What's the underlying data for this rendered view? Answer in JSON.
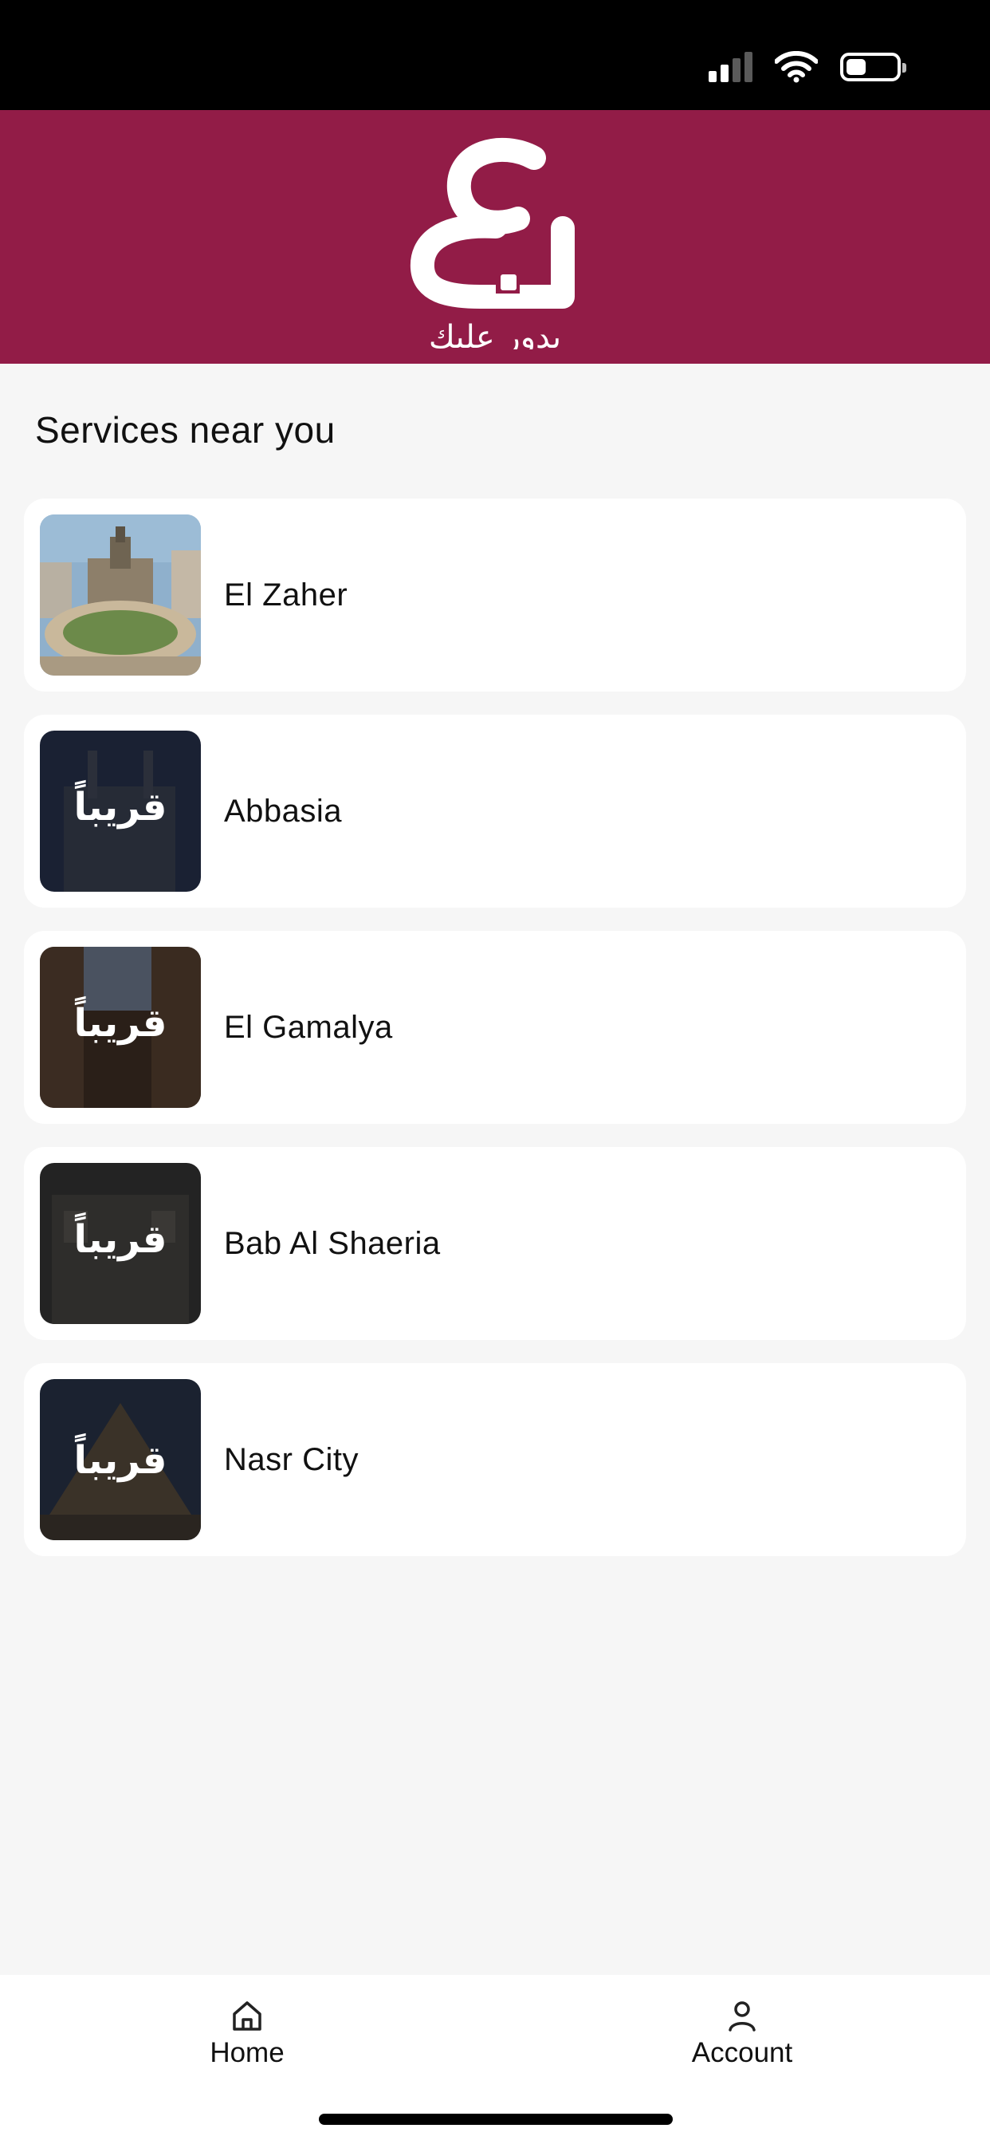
{
  "header": {
    "logo_glyph": "بع",
    "logo_tagline": "بدور عليك",
    "background_color": "#921c47"
  },
  "section": {
    "title": "Services near you"
  },
  "services": [
    {
      "label": "El Zaher",
      "thumbnail": "cairo-square-photo",
      "badge": ""
    },
    {
      "label": "Abbasia",
      "thumbnail": "coming-soon-badge",
      "badge": "قريباً"
    },
    {
      "label": "El Gamalya",
      "thumbnail": "coming-soon-badge",
      "badge": "قريباً"
    },
    {
      "label": "Bab Al Shaeria",
      "thumbnail": "coming-soon-badge",
      "badge": "قريباً"
    },
    {
      "label": "Nasr City",
      "thumbnail": "coming-soon-badge",
      "badge": "قريباً"
    }
  ],
  "bottom_nav": {
    "home_label": "Home",
    "account_label": "Account"
  },
  "status_bar": {
    "icons": [
      "cellular-signal-icon",
      "wifi-icon",
      "battery-icon"
    ]
  }
}
